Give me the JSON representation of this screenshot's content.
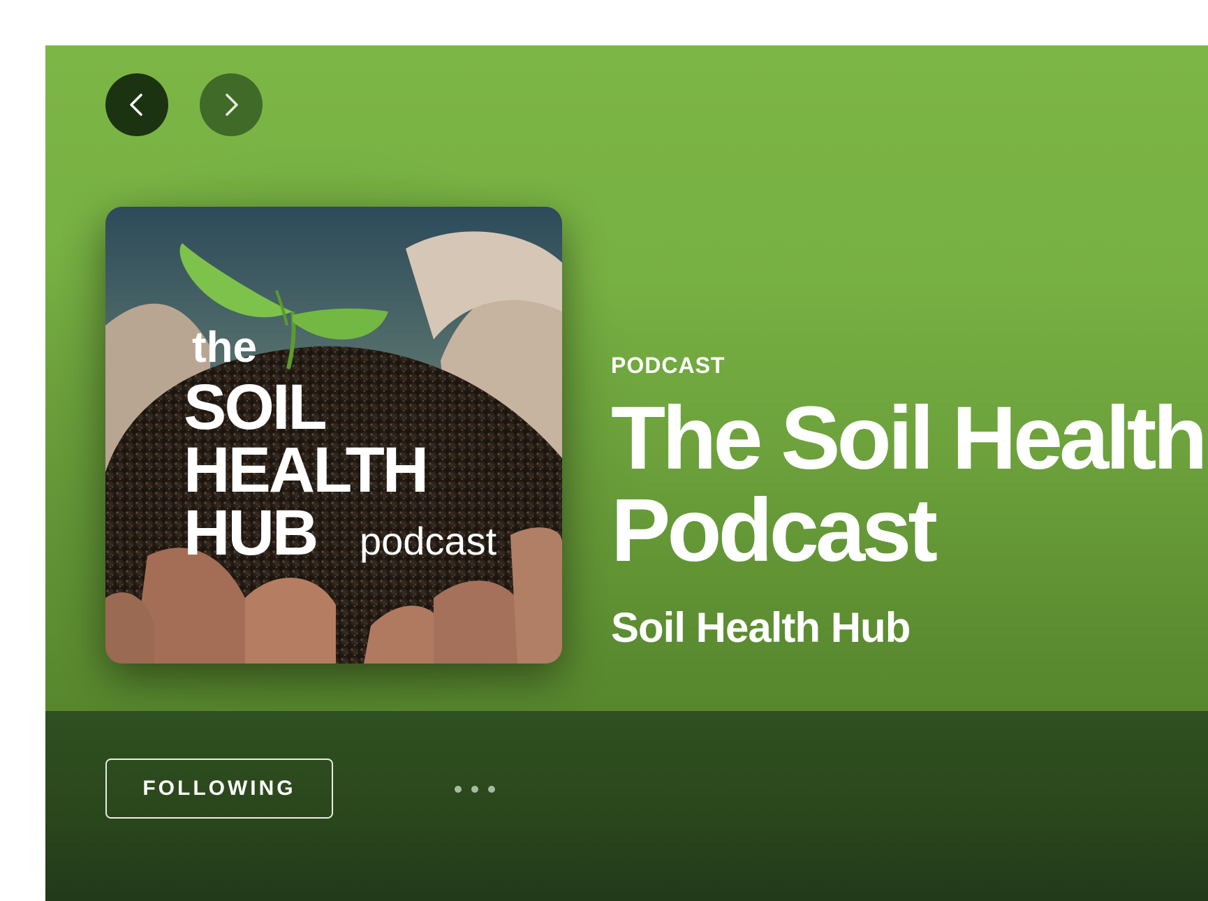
{
  "header": {
    "back_icon": "chevron-left-icon",
    "forward_icon": "chevron-right-icon"
  },
  "cover": {
    "text_the": "the",
    "text_soil": "SOIL",
    "text_health": "HEALTH",
    "text_hub": "HUB",
    "text_podcast": "podcast"
  },
  "show": {
    "type_label": "PODCAST",
    "title_line1": "The Soil Health",
    "title_line2": "Podcast",
    "author": "Soil Health Hub"
  },
  "actions": {
    "follow_label": "FOLLOWING",
    "more_icon": "more-options-icon"
  },
  "colors": {
    "hero_green": "#7cb646",
    "action_bar_green": "#2a471c",
    "text": "#ffffff"
  }
}
